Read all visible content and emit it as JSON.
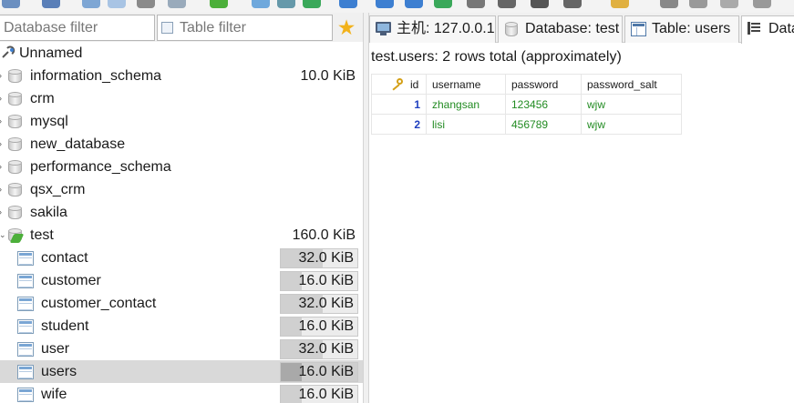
{
  "left_panel": {
    "database_filter_placeholder": "Database filter",
    "table_filter_placeholder": "Table filter",
    "favorites_icon": "star-icon",
    "connection": {
      "label": "Unnamed",
      "icon": "connection-icon"
    },
    "databases": [
      {
        "name": "information_schema",
        "size": "10.0 KiB"
      },
      {
        "name": "crm",
        "size": ""
      },
      {
        "name": "mysql",
        "size": ""
      },
      {
        "name": "new_database",
        "size": ""
      },
      {
        "name": "performance_schema",
        "size": ""
      },
      {
        "name": "qsx_crm",
        "size": ""
      },
      {
        "name": "sakila",
        "size": ""
      },
      {
        "name": "test",
        "size": "160.0 KiB",
        "expanded": true
      }
    ],
    "tables": [
      {
        "name": "contact",
        "size": "32.0 KiB",
        "relative_size": 0.55
      },
      {
        "name": "customer",
        "size": "16.0 KiB",
        "relative_size": 0.27
      },
      {
        "name": "customer_contact",
        "size": "32.0 KiB",
        "relative_size": 0.55
      },
      {
        "name": "student",
        "size": "16.0 KiB",
        "relative_size": 0.27
      },
      {
        "name": "user",
        "size": "32.0 KiB",
        "relative_size": 0.55
      },
      {
        "name": "users",
        "size": "16.0 KiB",
        "relative_size": 0.27,
        "selected": true
      },
      {
        "name": "wife",
        "size": "16.0 KiB",
        "relative_size": 0.27
      }
    ]
  },
  "tabs": {
    "host": "主机: 127.0.0.1",
    "database": "Database: test",
    "table": "Table: users",
    "data": "Data"
  },
  "result": {
    "title": "test.users: 2 rows total (approximately)",
    "columns": [
      "id",
      "username",
      "password",
      "password_salt"
    ],
    "rows": [
      [
        "1",
        "zhangsan",
        "123456",
        "wjw"
      ],
      [
        "2",
        "lisi",
        "456789",
        "wjw"
      ]
    ]
  },
  "colors": {
    "id_value": "#1f3fbf",
    "cell_value": "#228b22",
    "selection": "#d9d9d9",
    "star": "#f2b21b"
  }
}
